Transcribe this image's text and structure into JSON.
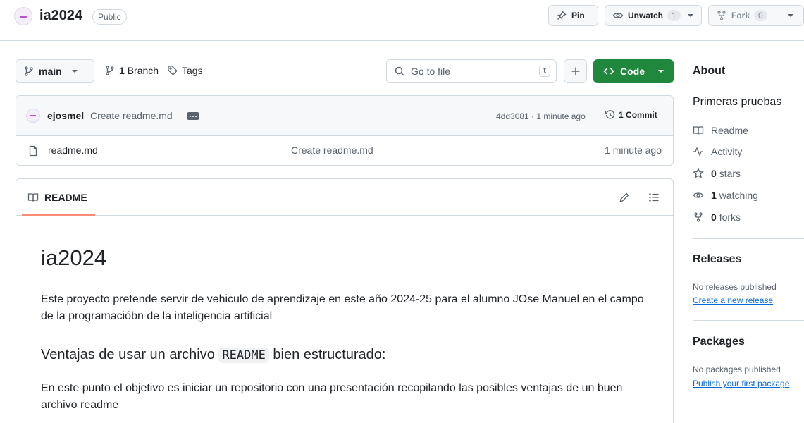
{
  "header": {
    "repo_name": "ia2024",
    "visibility": "Public",
    "pin_label": "Pin",
    "unwatch_label": "Unwatch",
    "unwatch_count": "1",
    "fork_label": "Fork",
    "fork_count": "0"
  },
  "toolbar": {
    "branch": "main",
    "branches_count": "1",
    "branches_label": "Branch",
    "tags_label": "Tags",
    "search_placeholder": "Go to file",
    "search_shortcut": "t",
    "code_label": "Code"
  },
  "commit": {
    "author": "ejosmel",
    "message": "Create readme.md",
    "hash_time": "4dd3081 · 1 minute ago",
    "commits_count": "1",
    "commits_label": "Commit"
  },
  "files": [
    {
      "name": "readme.md",
      "message": "Create readme.md",
      "time": "1 minute ago"
    }
  ],
  "readme": {
    "tab_label": "README",
    "h1": "ia2024",
    "p1": "Este proyecto pretende servir de vehiculo de aprendizaje en este año 2024-25 para el alumno JOse Manuel en el campo de la programacióbn de la inteligencia artificial",
    "h2_before": "Ventajas de usar un archivo",
    "h2_code": "README",
    "h2_after": "bien estructurado:",
    "p2": "En este punto el objetivo es iniciar un repositorio con una presentación recopilando las posibles ventajas de un buen archivo readme"
  },
  "sidebar": {
    "about_title": "About",
    "description": "Primeras pruebas",
    "readme_label": "Readme",
    "activity_label": "Activity",
    "stars_count": "0",
    "stars_label": "stars",
    "watching_count": "1",
    "watching_label": "watching",
    "forks_count": "0",
    "forks_label": "forks",
    "releases_title": "Releases",
    "releases_empty": "No releases published",
    "releases_link": "Create a new release",
    "packages_title": "Packages",
    "packages_empty": "No packages published",
    "packages_link": "Publish your first package"
  },
  "colors": {
    "accent_green": "#1f883d",
    "link_blue": "#0969da",
    "tab_underline": "#fd8c73"
  }
}
